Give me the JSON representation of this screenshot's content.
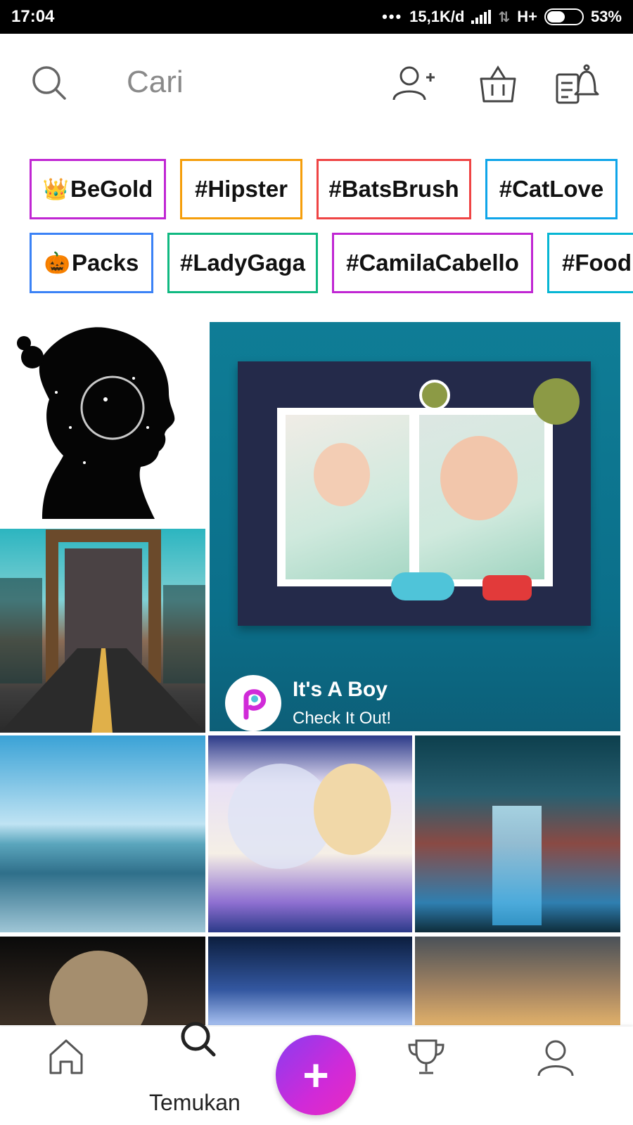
{
  "status_bar": {
    "time": "17:04",
    "dots": "•••",
    "network_speed": "15,1K/d",
    "network_type": "H+",
    "battery": "53%"
  },
  "header": {
    "search_placeholder": "Cari",
    "icons": [
      "search-icon",
      "add-friend-icon",
      "shop-bag-icon",
      "notifications-icon"
    ]
  },
  "hashtags": {
    "row1": [
      {
        "emoji": "👑",
        "text": "BeGold",
        "color": "#c026d3"
      },
      {
        "emoji": "",
        "text": "#Hipster",
        "color": "#f59e0b"
      },
      {
        "emoji": "",
        "text": "#BatsBrush",
        "color": "#ef4444"
      },
      {
        "emoji": "",
        "text": "#CatLove",
        "color": "#0ea5e9"
      }
    ],
    "row2": [
      {
        "emoji": "🎃",
        "text": "Packs",
        "color": "#3b82f6"
      },
      {
        "emoji": "",
        "text": "#LadyGaga",
        "color": "#10b981"
      },
      {
        "emoji": "",
        "text": "#CamilaCabello",
        "color": "#c026d3"
      },
      {
        "emoji": "",
        "text": "#Food",
        "color": "#06b6d4"
      }
    ]
  },
  "feature_card": {
    "title": "It's A Boy",
    "subtitle": "Check It Out!"
  },
  "bottom_nav": {
    "active_label": "Temukan",
    "fab_symbol": "+",
    "items": [
      "home-icon",
      "discover-icon",
      "create-button",
      "challenges-icon",
      "profile-icon"
    ],
    "fab_gradient": [
      "#8a3cf0",
      "#e92bc0"
    ]
  }
}
